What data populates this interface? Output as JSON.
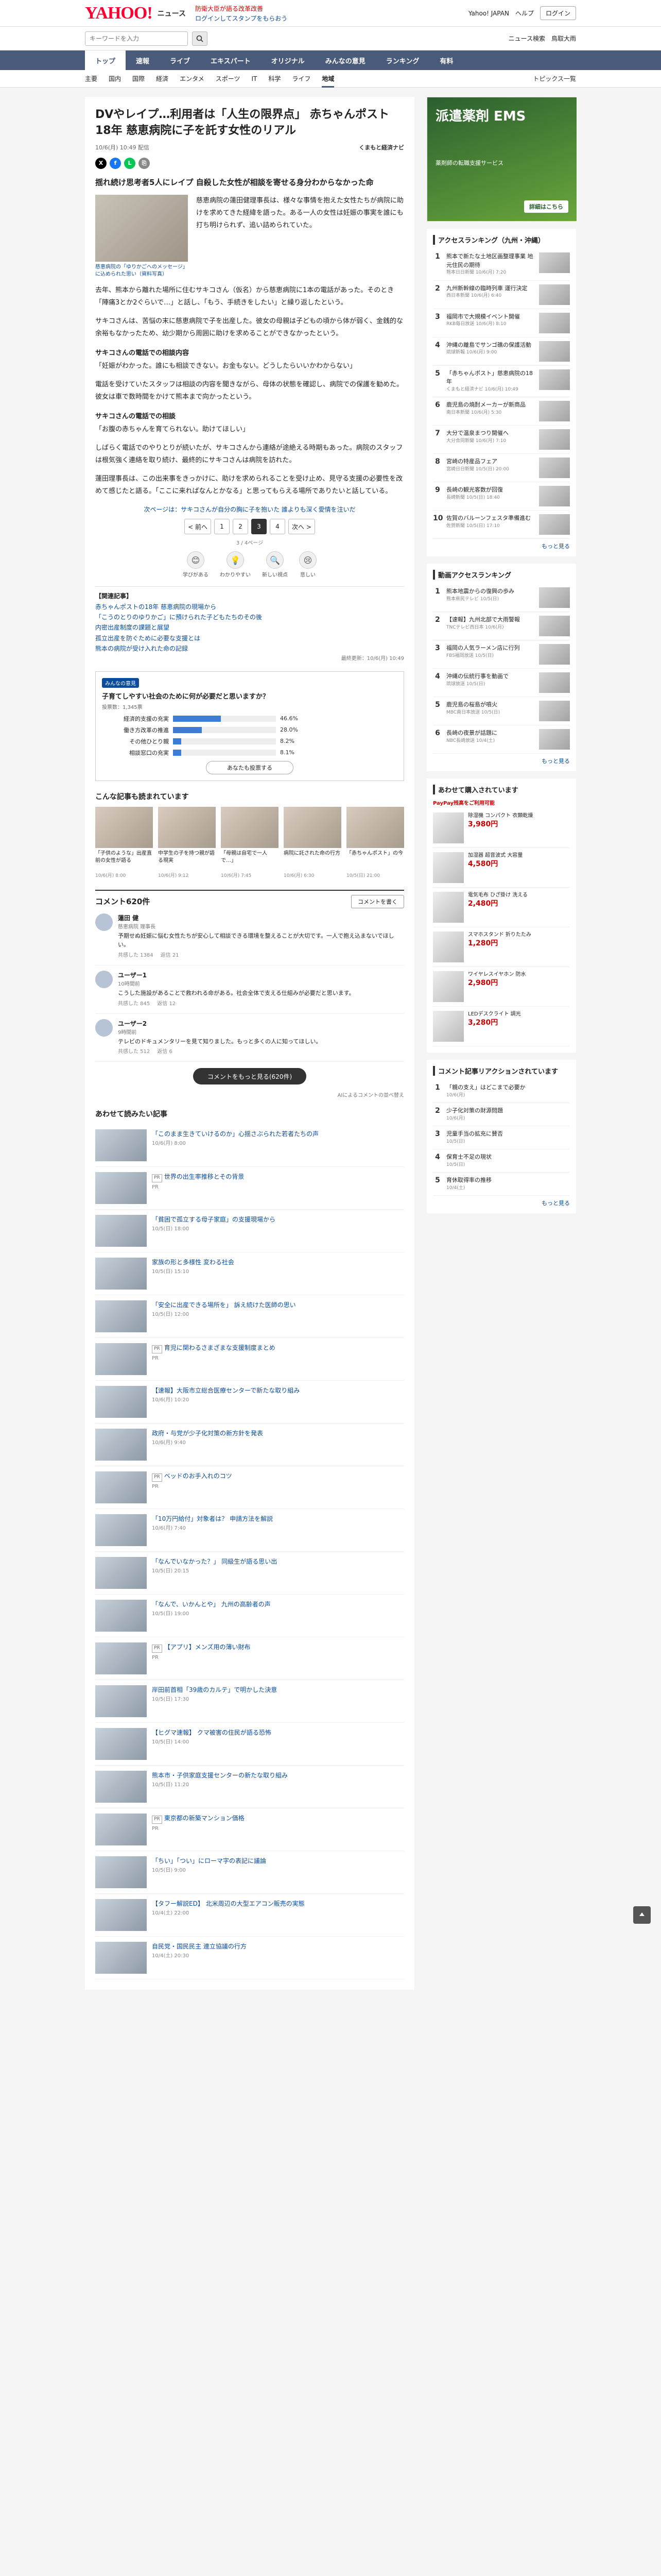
{
  "header": {
    "logo": "YAHOO!",
    "logo_sub": "ニュース",
    "msg1": "防衛大臣が語る改革改善",
    "msg2": "ログインしてスタンプをもらおう",
    "links": [
      "Yahoo! JAPAN",
      "ヘルプ"
    ],
    "login": "ログイン"
  },
  "search": {
    "placeholder": "キーワードを入力",
    "links": [
      "ニュース検索",
      "鳥取大雨"
    ]
  },
  "catnav": {
    "items": [
      "トップ",
      "速報",
      "ライブ",
      "エキスパート",
      "オリジナル",
      "みんなの意見",
      "ランキング",
      "有料"
    ],
    "active": 0,
    "topics": "トピックス一覧"
  },
  "subnav": {
    "items": [
      "主要",
      "国内",
      "国際",
      "経済",
      "エンタメ",
      "スポーツ",
      "IT",
      "科学",
      "ライフ",
      "地域"
    ],
    "active": 9,
    "pickup": "トピックス一覧"
  },
  "article": {
    "title": "DVやレイプ…利用者は「人生の限界点」 赤ちゃんポスト18年 慈恵病院に子を託す女性のリアル",
    "date": "10/6(月) 10:49 配信",
    "publisher": "くまもと経済ナビ",
    "lead": "揺れ続け思考者5人にレイプ 自殺した女性が相談を寄せる身分わからなかった命",
    "photo_caption": "慈恵病院の「ゆりかごへのメッセージ」に込められた思い（資料写真）",
    "paragraphs": [
      "慈恵病院の蓮田健理事長は、様々な事情を抱えた女性たちが病院に助けを求めてきた経緯を語った。ある一人の女性は妊娠の事実を誰にも打ち明けられず、追い詰められていた。",
      "去年、熊本から離れた場所に住むサキコさん（仮名）から慈恵病院に1本の電話があった。そのとき「陣痛3とか2ぐらいで…」と話し、「もう、手続きをしたい」と繰り返したという。",
      "サキコさんは、苦悩の末に慈恵病院で子を出産した。彼女の母親は子どもの頃から体が弱く、金銭的な余裕もなかったため、幼少期から周囲に助けを求めることができなかったという。",
      "サキコさんの電話での相談内容",
      "「妊娠がわかった。誰にも相談できない。お金もない。どうしたらいいかわからない」",
      "電話を受けていたスタッフは相談の内容を聞きながら、母体の状態を確認し、病院での保護を勧めた。彼女は車で数時間をかけて熊本まで向かったという。",
      "サキコさんの電話での相談",
      "「お腹の赤ちゃんを育てられない。助けてほしい」",
      "しばらく電話でのやりとりが続いたが、サキコさんから連絡が途絶える時期もあった。病院のスタッフは根気強く連絡を取り続け、最終的にサキコさんは病院を訪れた。",
      "蓮田理事長は、この出来事をきっかけに、助けを求められることを受け止め、見守る支援の必要性を改めて感じたと語る。「ここに来ればなんとかなる」と思ってもらえる場所でありたいと話している。"
    ],
    "next_link": "次ページは：サキコさんが自分の胸に子を抱いた 誰よりも深く愛情を注いだ",
    "pager": {
      "prev": "< 前へ",
      "pages": [
        "1",
        "2",
        "3",
        "4"
      ],
      "current": 2,
      "next": "次へ >"
    },
    "pager_note": "3 / 4ページ",
    "reactions": [
      {
        "icon": "😊",
        "label": "学びがある"
      },
      {
        "icon": "💡",
        "label": "わかりやすい"
      },
      {
        "icon": "🔍",
        "label": "新しい視点"
      },
      {
        "icon": "😢",
        "label": "悲しい"
      }
    ],
    "related_title": "【関連記事】",
    "related_links": [
      "赤ちゃんポストの18年 慈恵病院の現場から",
      "「こうのとりのゆりかご」に預けられた子どもたちのその後",
      "内密出産制度の課題と展望",
      "孤立出産を防ぐために必要な支援とは",
      "熊本の病院が受け入れた命の記録"
    ],
    "related_footnote": "最終更新：10/6(月) 10:49"
  },
  "poll": {
    "badge": "みんなの意見",
    "question": "子育てしやすい社会のために何が必要だと思いますか？",
    "meta": "投票数：1,345票",
    "options": [
      {
        "label": "経済的支援の充実",
        "pct": 46.6,
        "text": "46.6%"
      },
      {
        "label": "働き方改革の推進",
        "pct": 28.0,
        "text": "28.0%"
      },
      {
        "label": "その他ひとり親",
        "pct": 8.2,
        "text": "8.2%"
      },
      {
        "label": "相談窓口の充実",
        "pct": 8.1,
        "text": "8.1%"
      }
    ],
    "button": "あなたも投票する"
  },
  "recommended": {
    "title": "こんな記事も読まれています",
    "cards": [
      {
        "title": "「子供のような」出産直前の女性が語る",
        "meta": "10/6(月) 8:00"
      },
      {
        "title": "中学生の子を持つ親が語る現実",
        "meta": "10/6(月) 9:12"
      },
      {
        "title": "「母親は自宅で一人で…」",
        "meta": "10/6(月) 7:45"
      },
      {
        "title": "病院に託された命の行方",
        "meta": "10/6(月) 6:30"
      },
      {
        "title": "「赤ちゃんポスト」の今",
        "meta": "10/5(日) 21:00"
      }
    ]
  },
  "comments": {
    "title": "コメント620件",
    "write_btn": "コメントを書く",
    "items": [
      {
        "name": "蓮田 健",
        "sub": "慈恵病院 理事長",
        "text": "予期せぬ妊娠に悩む女性たちが安心して相談できる環境を整えることが大切です。一人で抱え込まないでほしい。",
        "likes": "共感した 1384",
        "replies": "返信 21"
      },
      {
        "name": "ユーザー1",
        "sub": "10時間前",
        "text": "こうした施設があることで救われる命がある。社会全体で支える仕組みが必要だと思います。",
        "likes": "共感した 845",
        "replies": "返信 12"
      },
      {
        "name": "ユーザー2",
        "sub": "9時間前",
        "text": "テレビのドキュメンタリーを見て知りました。もっと多くの人に知ってほしい。",
        "likes": "共感した 512",
        "replies": "返信 6"
      }
    ],
    "more": "コメントをもっと見る(620件)",
    "ai_note": "AIによるコメントの並べ替え"
  },
  "also_read": {
    "title": "あわせて読みたい記事",
    "items": [
      {
        "title": "「このまま生きていけるのか」心揺さぶられた若者たちの声",
        "meta": "10/6(月) 8:00",
        "pr": ""
      },
      {
        "title": "世界の出生率推移とその背景",
        "meta": "PR",
        "pr": "PR"
      },
      {
        "title": "「貧困で孤立する母子家庭」の支援現場から",
        "meta": "10/5(日) 18:00",
        "pr": ""
      },
      {
        "title": "家族の形と多様性 変わる社会",
        "meta": "10/5(日) 15:10",
        "pr": ""
      },
      {
        "title": "「安全に出産できる場所を」 訴え続けた医師の思い",
        "meta": "10/5(日) 12:00",
        "pr": ""
      },
      {
        "title": "育児に関わるさまざまな支援制度まとめ",
        "meta": "PR",
        "pr": "PR"
      },
      {
        "title": "【速報】大阪市立総合医療センターで新たな取り組み",
        "meta": "10/6(月) 10:20",
        "pr": ""
      },
      {
        "title": "政府・与党が少子化対策の新方針を発表",
        "meta": "10/6(月) 9:40",
        "pr": ""
      },
      {
        "title": "ベッドのお手入れのコツ",
        "meta": "PR",
        "pr": "PR"
      },
      {
        "title": "「10万円給付」対象者は？ 申請方法を解説",
        "meta": "10/6(月) 7:40",
        "pr": ""
      },
      {
        "title": "「なんでいなかった？」 同級生が語る思い出",
        "meta": "10/5(日) 20:15",
        "pr": ""
      },
      {
        "title": "「なんで、いかんとや」 九州の高齢者の声",
        "meta": "10/5(日) 19:00",
        "pr": ""
      },
      {
        "title": "【アプリ】メンズ用の薄い財布",
        "meta": "PR",
        "pr": "PR"
      },
      {
        "title": "岸田前首相「39歳のカルテ」で明かした決意",
        "meta": "10/5(日) 17:30",
        "pr": ""
      },
      {
        "title": "【ヒグマ速報】 クマ被害の住民が語る恐怖",
        "meta": "10/5(日) 14:00",
        "pr": ""
      },
      {
        "title": "熊本市・子供家庭支援センターの新たな取り組み",
        "meta": "10/5(日) 11:20",
        "pr": ""
      },
      {
        "title": "東京都の新築マンション価格",
        "meta": "PR",
        "pr": "PR"
      },
      {
        "title": "「ちい」「つい」にローマ字の表記に議論",
        "meta": "10/5(日) 9:00",
        "pr": ""
      },
      {
        "title": "【タフー解説ED】 北米周辺の大型エアコン販売の実態",
        "meta": "10/4(土) 22:00",
        "pr": ""
      },
      {
        "title": "自民党・国民民主 連立協議の行方",
        "meta": "10/4(土) 20:30",
        "pr": ""
      }
    ]
  },
  "side": {
    "ad": {
      "big": "派遣薬剤 EMS",
      "small": "薬剤師の転職支援サービス",
      "cta": "詳細はこちら"
    },
    "access_title": "アクセスランキング（九州・沖縄）",
    "access": [
      {
        "title": "熊本で新たな土地区画整理事業 地元住民の期待",
        "meta": "熊本日日新聞 10/6(月) 7:20"
      },
      {
        "title": "九州新幹線の臨時列車 運行決定",
        "meta": "西日本新聞 10/6(月) 6:40"
      },
      {
        "title": "福岡市で大規模イベント開催",
        "meta": "RKB毎日放送 10/6(月) 8:10"
      },
      {
        "title": "沖縄の離島でサンゴ礁の保護活動",
        "meta": "琉球新報 10/6(月) 9:00"
      },
      {
        "title": "「赤ちゃんポスト」慈恵病院の18年",
        "meta": "くまもと経済ナビ 10/6(月) 10:49"
      },
      {
        "title": "鹿児島の焼酎メーカーが新商品",
        "meta": "南日本新聞 10/6(月) 5:30"
      },
      {
        "title": "大分で温泉まつり開催へ",
        "meta": "大分合同新聞 10/6(月) 7:10"
      },
      {
        "title": "宮崎の特産品フェア",
        "meta": "宮崎日日新聞 10/5(日) 20:00"
      },
      {
        "title": "長崎の観光客数が回復",
        "meta": "長崎新聞 10/5(日) 18:40"
      },
      {
        "title": "佐賀のバルーンフェスタ準備進む",
        "meta": "佐賀新聞 10/5(日) 17:10"
      }
    ],
    "news_rank_title": "動画アクセスランキング",
    "news_rank": [
      {
        "title": "熊本地震からの復興の歩み",
        "meta": "熊本県民テレビ 10/5(日)"
      },
      {
        "title": "【速報】九州北部で大雨警報",
        "meta": "TNCテレビ西日本 10/6(月)"
      },
      {
        "title": "福岡の人気ラーメン店に行列",
        "meta": "FBS福岡放送 10/5(日)"
      },
      {
        "title": "沖縄の伝統行事を動画で",
        "meta": "琉球放送 10/5(日)"
      },
      {
        "title": "鹿児島の桜島が噴火",
        "meta": "MBC南日本放送 10/5(日)"
      },
      {
        "title": "長崎の夜景が話題に",
        "meta": "NBC長崎放送 10/4(土)"
      }
    ],
    "more": "もっと見る",
    "shop_title": "あわせて購入されています",
    "paypay": "PayPay残高をご利用可能",
    "shop": [
      {
        "title": "除湿機 コンパクト 衣類乾燥",
        "price": "3,980円"
      },
      {
        "title": "加湿器 超音波式 大容量",
        "price": "4,580円"
      },
      {
        "title": "電気毛布 ひざ掛け 洗える",
        "price": "2,480円"
      },
      {
        "title": "スマホスタンド 折りたたみ",
        "price": "1,280円"
      },
      {
        "title": "ワイヤレスイヤホン 防水",
        "price": "2,980円"
      },
      {
        "title": "LEDデスクライト 調光",
        "price": "3,280円"
      }
    ],
    "comment_rank_title": "コメント記事リアクションされています",
    "comment_rank": [
      {
        "title": "「親の支え」はどこまで必要か",
        "meta": "10/6(月)"
      },
      {
        "title": "少子化対策の財源問題",
        "meta": "10/6(月)"
      },
      {
        "title": "児童手当の拡充に賛否",
        "meta": "10/5(日)"
      },
      {
        "title": "保育士不足の現状",
        "meta": "10/5(日)"
      },
      {
        "title": "育休取得率の推移",
        "meta": "10/4(土)"
      }
    ]
  },
  "colors": {
    "accent": "#ff0033",
    "nav": "#4a5a7a",
    "link": "#0a4b9c",
    "poll_bar": "#3c7bd6"
  }
}
